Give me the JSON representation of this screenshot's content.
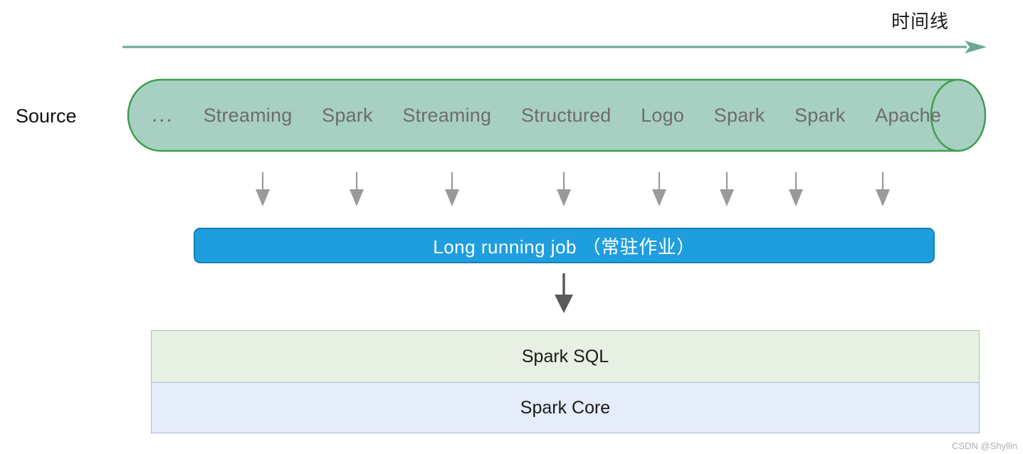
{
  "timeline": {
    "label": "时间线",
    "arrow_icon": "arrow-right-icon",
    "color": "#6ba898"
  },
  "source": {
    "label": "Source"
  },
  "cylinder": {
    "fill_color": "#a8d0c2",
    "border_color": "#3f9e4d",
    "items": [
      {
        "label": "..."
      },
      {
        "label": "Streaming"
      },
      {
        "label": "Spark"
      },
      {
        "label": "Streaming"
      },
      {
        "label": "Structured"
      },
      {
        "label": "Logo"
      },
      {
        "label": "Spark"
      },
      {
        "label": "Spark"
      },
      {
        "label": "Apache"
      }
    ]
  },
  "feed_arrows": {
    "icon": "arrow-down-icon",
    "color": "#9a9a9a",
    "positions": [
      369,
      501,
      635,
      792,
      926,
      1021,
      1118,
      1240
    ]
  },
  "job_bar": {
    "label": "Long running job （常驻作业）",
    "fill_color": "#1f9edf",
    "border_color": "#0f7fba",
    "text_color": "#ffffff"
  },
  "mid_arrow": {
    "icon": "arrow-down-icon",
    "color": "#5a5a5a"
  },
  "stack": {
    "layers": [
      {
        "label": "Spark SQL",
        "fill_color": "#e7f0e3",
        "border_color": "#a9c79b"
      },
      {
        "label": "Spark Core",
        "fill_color": "#e6edfa",
        "border_color": "#a9bbd8"
      }
    ]
  },
  "watermark": {
    "text": "CSDN @Shyllin"
  }
}
